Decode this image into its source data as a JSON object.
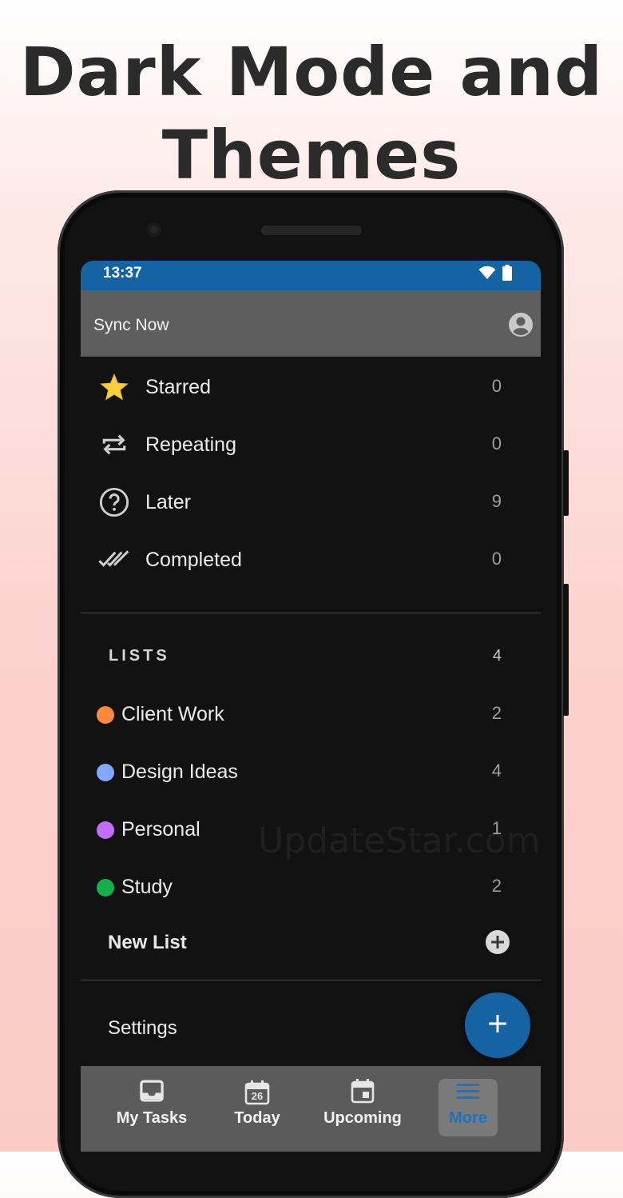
{
  "headline": {
    "line1": "Dark Mode and",
    "line2": "Themes"
  },
  "status_bar": {
    "time": "13:37"
  },
  "sync": {
    "label": "Sync Now"
  },
  "filters": [
    {
      "label": "Starred",
      "count": "0",
      "icon": "star-icon"
    },
    {
      "label": "Repeating",
      "count": "0",
      "icon": "repeat-icon"
    },
    {
      "label": "Later",
      "count": "9",
      "icon": "question-circle-icon"
    },
    {
      "label": "Completed",
      "count": "0",
      "icon": "double-check-icon"
    }
  ],
  "lists": {
    "heading": "LISTS",
    "count": "4",
    "items": [
      {
        "label": "Client Work",
        "count": "2",
        "color": "#ff8a3d"
      },
      {
        "label": "Design Ideas",
        "count": "4",
        "color": "#85a8ff"
      },
      {
        "label": "Personal",
        "count": "1",
        "color": "#c46cff"
      },
      {
        "label": "Study",
        "count": "2",
        "color": "#12b14c"
      }
    ],
    "new_list_label": "New List"
  },
  "settings_label": "Settings",
  "watermark": "UpdateStar.com",
  "bottom_nav": [
    {
      "label": "My Tasks",
      "icon": "inbox-icon",
      "active": false
    },
    {
      "label": "Today",
      "icon": "calendar-today-icon",
      "day": "26",
      "active": false
    },
    {
      "label": "Upcoming",
      "icon": "calendar-event-icon",
      "active": false
    },
    {
      "label": "More",
      "icon": "menu-icon",
      "active": true
    }
  ],
  "colors": {
    "accent": "#1563a3",
    "active_tab_text": "#1b73c2",
    "surface": "#121212",
    "sync_bar": "#5e5e5e"
  }
}
